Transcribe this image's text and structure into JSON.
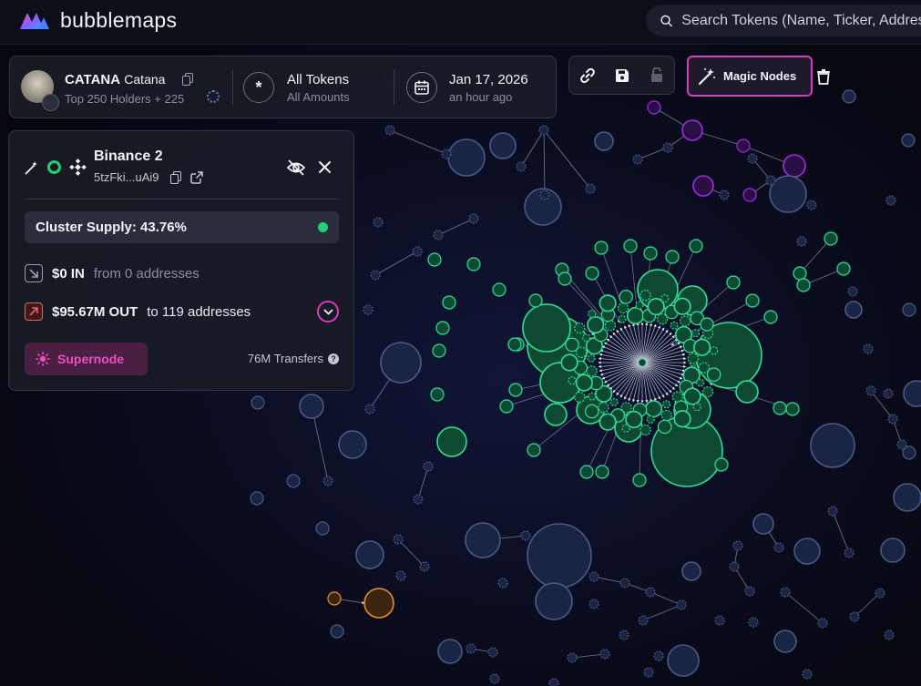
{
  "app": {
    "name": "bubblemaps"
  },
  "search": {
    "placeholder": "Search Tokens (Name, Ticker, Address)",
    "icon": "search-icon"
  },
  "token": {
    "ticker": "CATANA",
    "name": "Catana",
    "holders_text": "Top 250 Holders + 225"
  },
  "filters": {
    "tokens_label": "All Tokens",
    "amounts_label": "All Amounts",
    "date_label": "Jan 17, 2026",
    "date_relative": "an hour ago"
  },
  "toolbar": {
    "magic_nodes_label": "Magic Nodes"
  },
  "panel": {
    "title": "Binance 2",
    "address": "5tzFki...uAi9",
    "cluster_supply": "Cluster Supply: 43.76%",
    "in_amount": "$0 IN",
    "in_desc": "from 0 addresses",
    "out_amount": "$95.67M OUT",
    "out_desc": "to 119 addresses",
    "supernode_label": "Supernode",
    "transfers_label": "76M Transfers"
  },
  "colors": {
    "background": "#06070f",
    "node": "#1a2444",
    "node_stroke": "#4a5a86",
    "cluster": "#0d4a31",
    "cluster_stroke": "#2ee09a",
    "magic": "#a02ae6",
    "orange": "#f18a26",
    "accent": "#d63bc2"
  },
  "graph": {
    "nodes": 0
  }
}
